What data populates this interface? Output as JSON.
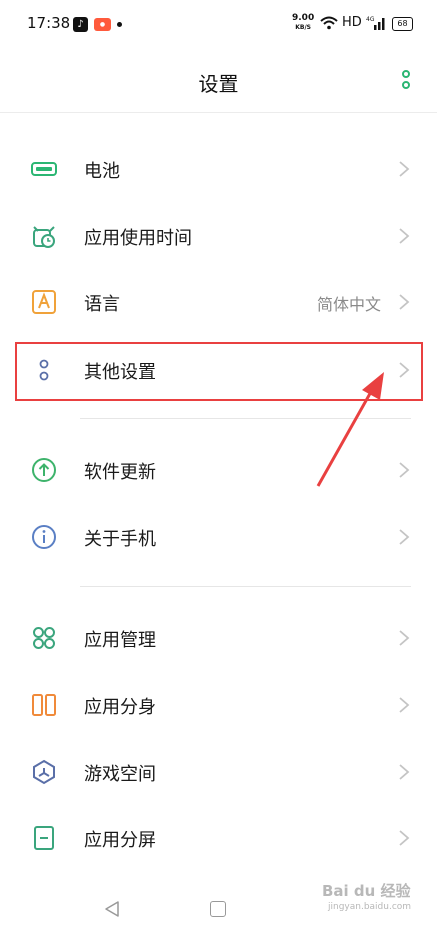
{
  "status_bar": {
    "time": "17:38",
    "net_speed": "9.00",
    "net_speed_unit": "KB/S",
    "hd": "HD",
    "signal": "4G",
    "battery": "68"
  },
  "header": {
    "title": "设置"
  },
  "settings": {
    "battery": {
      "label": "电池",
      "icon": "battery-icon"
    },
    "app_usage_time": {
      "label": "应用使用时间",
      "icon": "alarm-clock-icon"
    },
    "language": {
      "label": "语言",
      "value": "简体中文",
      "icon": "font-a-icon"
    },
    "other_settings": {
      "label": "其他设置",
      "icon": "dots-icon"
    },
    "software_update": {
      "label": "软件更新",
      "icon": "arrow-up-circle-icon"
    },
    "about_phone": {
      "label": "关于手机",
      "icon": "info-circle-icon"
    },
    "app_management": {
      "label": "应用管理",
      "icon": "grid-icon"
    },
    "app_clone": {
      "label": "应用分身",
      "icon": "split-rect-icon"
    },
    "game_space": {
      "label": "游戏空间",
      "icon": "hexagon-icon"
    },
    "split_screen": {
      "label": "应用分屏",
      "icon": "split-screen-icon"
    }
  },
  "colors": {
    "accent_green": "#2bb673",
    "highlight_red": "#e94040",
    "language_orange": "#f0a23a",
    "update_green": "#3db36b",
    "about_blue": "#5a7fc4",
    "clone_orange": "#f08a3a",
    "game_blue": "#5a6fa8",
    "split_green": "#3aa57d"
  },
  "watermark": {
    "brand": "Bai du 经验",
    "url": "jingyan.baidu.com"
  }
}
